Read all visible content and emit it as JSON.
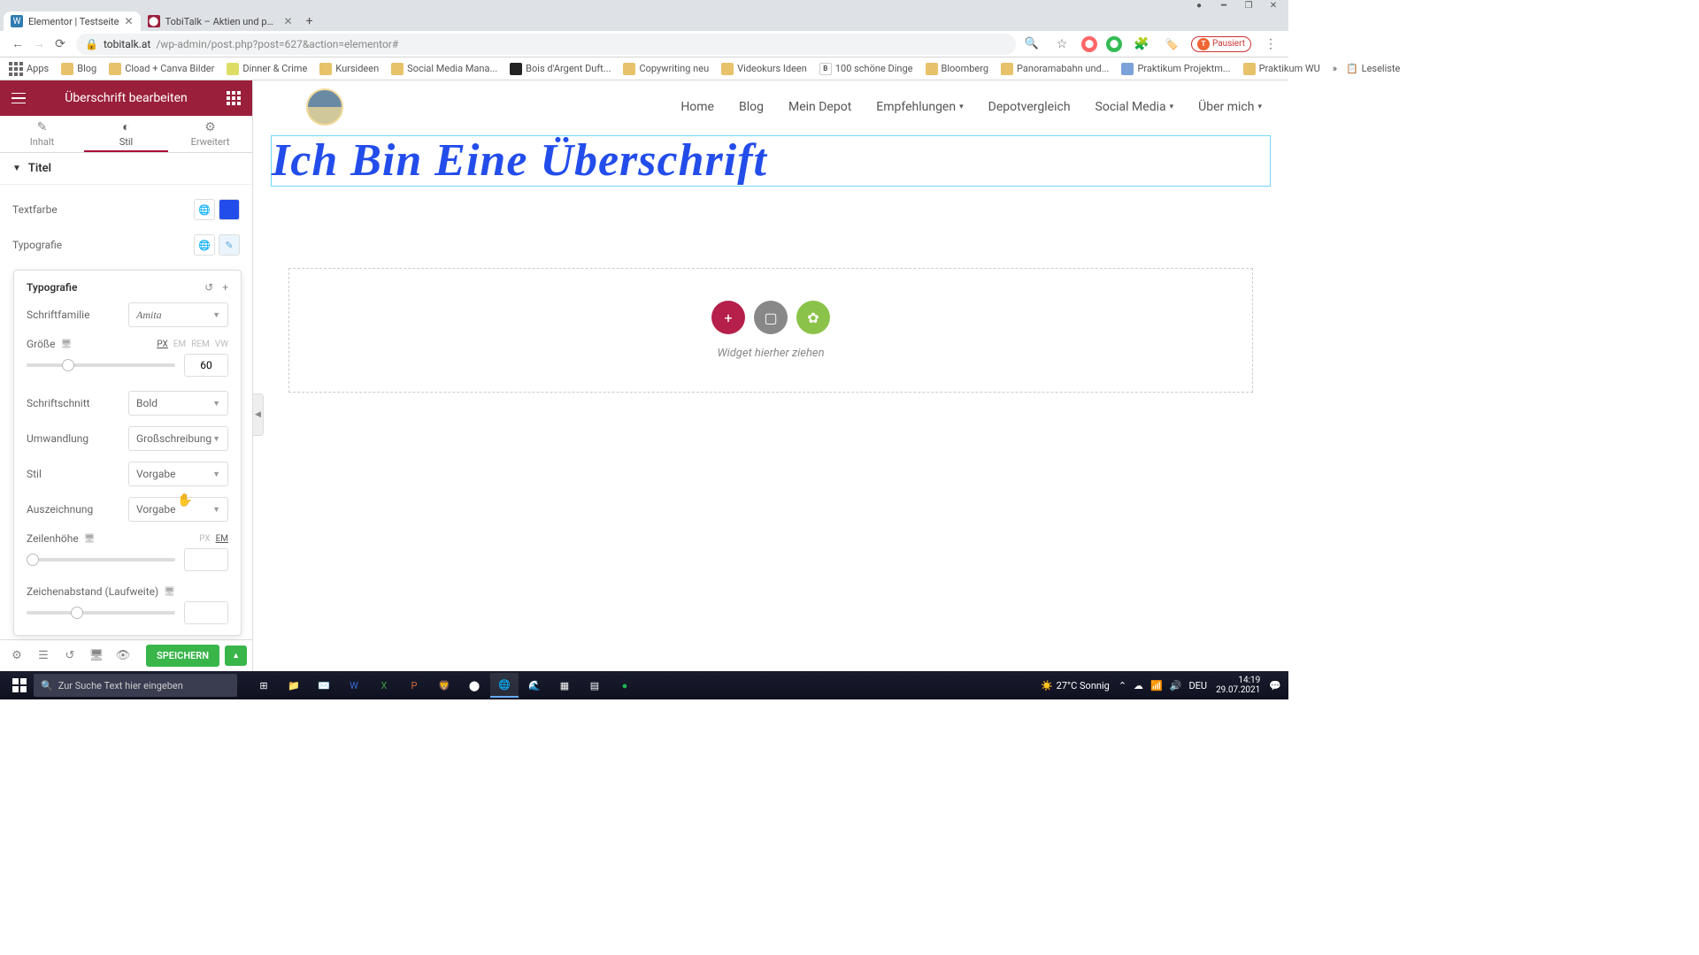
{
  "chrome": {
    "tabs": [
      {
        "title": "Elementor | Testseite",
        "favicon": "wp",
        "active": true
      },
      {
        "title": "TobiTalk – Aktien und persönlich...",
        "favicon": "tt",
        "active": false
      }
    ],
    "url_host": "tobitalk.at",
    "url_path": "/wp-admin/post.php?post=627&action=elementor#",
    "pausiert": "Pausiert",
    "bookmarks": [
      {
        "label": "Apps",
        "fav": "apps"
      },
      {
        "label": "Blog",
        "color": "#e8c26a"
      },
      {
        "label": "Cload + Canva Bilder",
        "color": "#e8c26a"
      },
      {
        "label": "Dinner & Crime",
        "color": "#dd6"
      },
      {
        "label": "Kursideen",
        "color": "#e8c26a"
      },
      {
        "label": "Social Media Mana...",
        "color": "#e8c26a"
      },
      {
        "label": "Bois d'Argent Duft...",
        "color": "#222"
      },
      {
        "label": "Copywriting neu",
        "color": "#e8c26a"
      },
      {
        "label": "Videokurs Ideen",
        "color": "#e8c26a"
      },
      {
        "label": "100 schöne Dinge",
        "color": "#fff"
      },
      {
        "label": "Bloomberg",
        "color": "#e8c26a"
      },
      {
        "label": "Panoramabahn und...",
        "color": "#e8c26a"
      },
      {
        "label": "Praktikum Projektm...",
        "color": "#7aa2d8"
      },
      {
        "label": "Praktikum WU",
        "color": "#e8c26a"
      }
    ],
    "overflow": "»",
    "leseliste": "Leseliste"
  },
  "elementor": {
    "header": "Überschrift bearbeiten",
    "tabs": {
      "inhalt": "Inhalt",
      "stil": "Stil",
      "erweitert": "Erweitert"
    },
    "section": "Titel",
    "textfarbe_label": "Textfarbe",
    "textfarbe_color": "#234deb",
    "typografie_label": "Typografie",
    "typo": {
      "title": "Typografie",
      "family_label": "Schriftfamilie",
      "family_value": "Amita",
      "size_label": "Größe",
      "size_units": [
        "PX",
        "EM",
        "REM",
        "VW"
      ],
      "size_value": "60",
      "weight_label": "Schriftschnitt",
      "weight_value": "Bold",
      "transform_label": "Umwandlung",
      "transform_value": "Großschreibung",
      "style_label": "Stil",
      "style_value": "Vorgabe",
      "decoration_label": "Auszeichnung",
      "decoration_value": "Vorgabe",
      "lineheight_label": "Zeilenhöhe",
      "lineheight_units": [
        "PX",
        "EM"
      ],
      "lineheight_value": "",
      "spacing_label": "Zeichenabstand (Laufweite)",
      "spacing_value": ""
    },
    "footer": {
      "save": "SPEICHERN"
    }
  },
  "canvas": {
    "nav": [
      "Home",
      "Blog",
      "Mein Depot",
      "Empfehlungen",
      "Depotvergleich",
      "Social Media",
      "Über mich"
    ],
    "heading": "Ich Bin Eine Überschrift",
    "dropzone_text": "Widget hierher ziehen"
  },
  "taskbar": {
    "search_placeholder": "Zur Suche Text hier eingeben",
    "weather": "27°C  Sonnig",
    "lang": "DEU",
    "time": "14:19",
    "date": "29.07.2021"
  }
}
